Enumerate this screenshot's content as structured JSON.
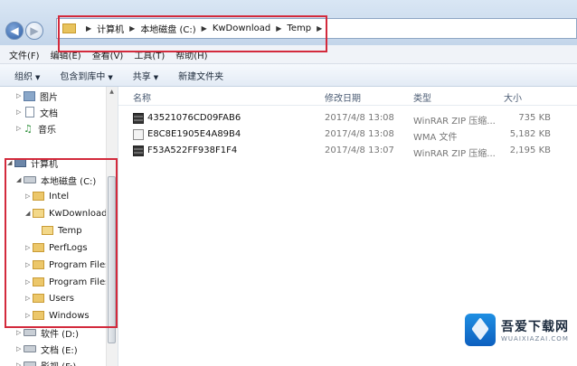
{
  "address_bar": {
    "crumbs": [
      "计算机",
      "本地磁盘 (C:)",
      "KwDownload",
      "Temp"
    ]
  },
  "menu": {
    "items": [
      "文件(F)",
      "编辑(E)",
      "查看(V)",
      "工具(T)",
      "帮助(H)"
    ]
  },
  "toolbar": {
    "organize": "组织",
    "include_library": "包含到库中",
    "share": "共享",
    "new_folder": "新建文件夹"
  },
  "nav_tree": {
    "pictures": "图片",
    "documents": "文档",
    "music": "音乐",
    "computer": "计算机",
    "drive_c": "本地磁盘 (C:)",
    "intel": "Intel",
    "kwdownload": "KwDownload",
    "temp": "Temp",
    "perflogs": "PerfLogs",
    "program_files_1": "Program Files",
    "program_files_2": "Program Files",
    "users": "Users",
    "windows": "Windows",
    "drive_d": "软件 (D:)",
    "drive_e": "文档 (E:)",
    "drive_f": "影视 (F:)"
  },
  "columns": {
    "name": "名称",
    "modified": "修改日期",
    "type": "类型",
    "size": "大小"
  },
  "files": [
    {
      "name": "43521076CD09FAB6",
      "modified": "2017/4/8 13:08",
      "type": "WinRAR ZIP 压缩...",
      "size": "735 KB",
      "icon": "archive-icon"
    },
    {
      "name": "E8C8E1905E4A89B4",
      "modified": "2017/4/8 13:08",
      "type": "WMA 文件",
      "size": "5,182 KB",
      "icon": "audio-file-icon"
    },
    {
      "name": "F53A522FF938F1F4",
      "modified": "2017/4/8 13:07",
      "type": "WinRAR ZIP 压缩...",
      "size": "2,195 KB",
      "icon": "archive-icon"
    }
  ],
  "watermark": {
    "title": "吾爱下载网",
    "subtitle": "WUAIXIAZAI.COM"
  },
  "colors": {
    "highlight_box": "#d32a3c",
    "folder": "#ecc76a",
    "title_bar": "#c3d5ea"
  }
}
